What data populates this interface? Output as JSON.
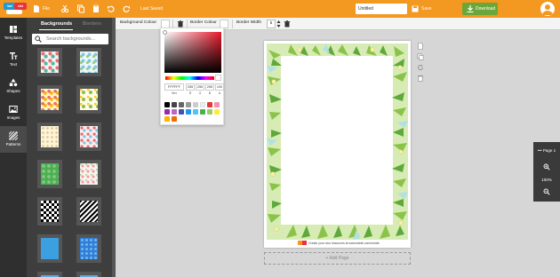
{
  "topbar": {
    "logo": "twinkl create",
    "file_label": "File",
    "status": "Last Saved",
    "doc_title": "Untitled",
    "save_label": "Save",
    "download_label": "Download"
  },
  "rail": {
    "items": [
      {
        "label": "Templates",
        "icon": "templates-icon"
      },
      {
        "label": "Text",
        "icon": "text-icon"
      },
      {
        "label": "Shapes",
        "icon": "shapes-icon"
      },
      {
        "label": "Images",
        "icon": "images-icon"
      },
      {
        "label": "Patterns",
        "icon": "patterns-icon"
      }
    ]
  },
  "panel": {
    "tab_active": "Backgrounds",
    "tab_inactive": "Borders",
    "search_placeholder": "Search backgrounds..."
  },
  "subbar": {
    "bg_colour_label": "Background Colour",
    "border_colour_label": "Border Colour",
    "border_width_label": "Border Width",
    "border_width_value": "5"
  },
  "picker": {
    "hex": "FFFFFF",
    "r": "255",
    "g": "255",
    "b": "255",
    "a": "100",
    "hex_label": "Hex",
    "r_label": "R",
    "g_label": "G",
    "b_label": "B",
    "a_label": "A"
  },
  "canvas": {
    "footer_text": "Create your own resources at www.twinkl.com/create",
    "add_page": "+ Add Page"
  },
  "zoom": {
    "page_label": "Page 1",
    "zoom_level": "100%"
  },
  "colors": {
    "accent": "#f39820",
    "download": "#6ba638",
    "panel": "#3e3e3e",
    "rail": "#2f2f2f"
  }
}
